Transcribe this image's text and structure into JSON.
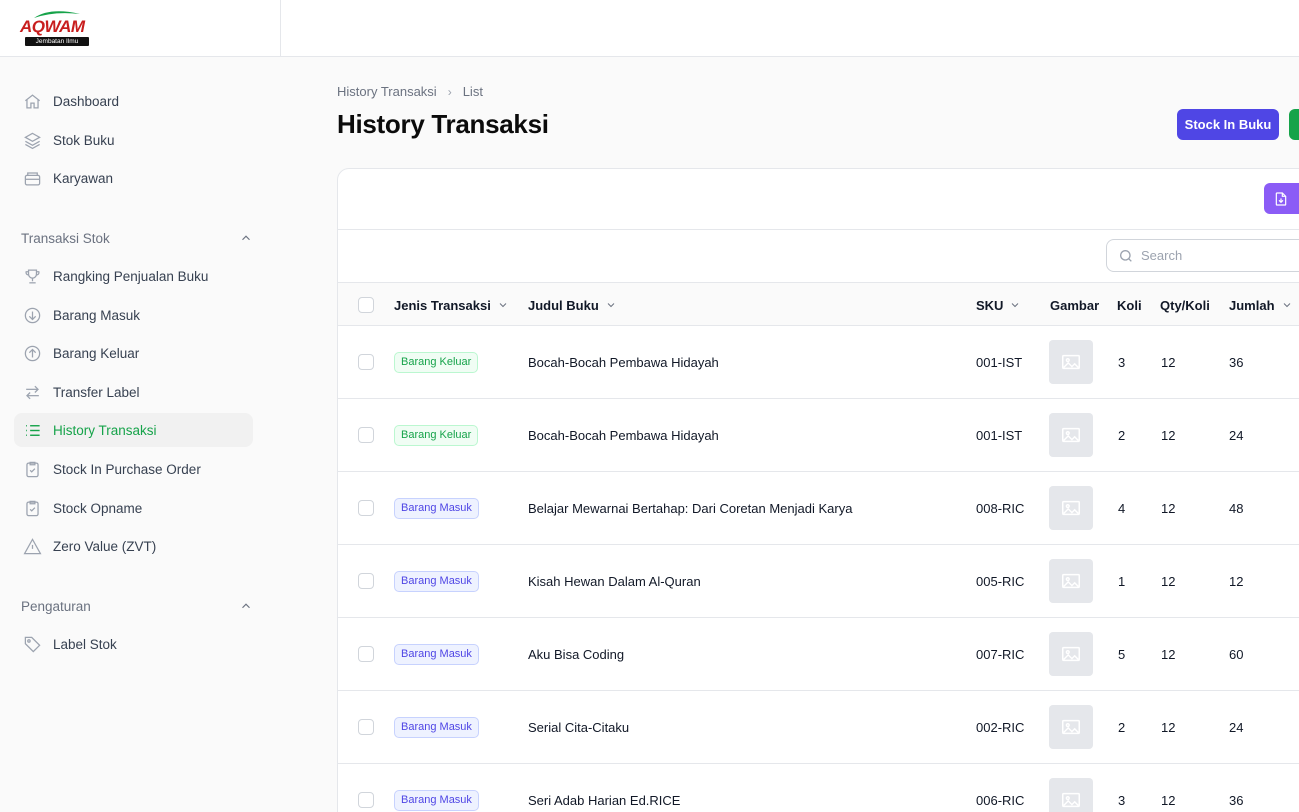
{
  "brand": {
    "name": "AQWAM",
    "tagline": "Jembatan Ilmu"
  },
  "sidebar": {
    "top_items": [
      {
        "label": "Dashboard",
        "icon": "home-icon"
      },
      {
        "label": "Stok Buku",
        "icon": "layers-icon"
      },
      {
        "label": "Karyawan",
        "icon": "inbox-icon"
      }
    ],
    "groups": [
      {
        "title": "Transaksi Stok",
        "items": [
          {
            "label": "Rangking Penjualan Buku",
            "icon": "trophy-icon"
          },
          {
            "label": "Barang Masuk",
            "icon": "arrow-down-circle-icon"
          },
          {
            "label": "Barang Keluar",
            "icon": "arrow-up-circle-icon"
          },
          {
            "label": "Transfer Label",
            "icon": "arrows-right-left-icon"
          },
          {
            "label": "History Transaksi",
            "icon": "list-icon",
            "active": true
          },
          {
            "label": "Stock In Purchase Order",
            "icon": "clipboard-check-icon"
          },
          {
            "label": "Stock Opname",
            "icon": "clipboard-check-icon"
          },
          {
            "label": "Zero Value (ZVT)",
            "icon": "warning-icon"
          }
        ]
      },
      {
        "title": "Pengaturan",
        "items": [
          {
            "label": "Label Stok",
            "icon": "tag-icon"
          }
        ]
      }
    ]
  },
  "breadcrumb": {
    "parent": "History Transaksi",
    "current": "List"
  },
  "page": {
    "title": "History Transaksi",
    "primary_action": "Stock In Buku"
  },
  "table": {
    "search_placeholder": "Search",
    "columns": {
      "jenis": "Jenis Transaksi",
      "judul": "Judul Buku",
      "sku": "SKU",
      "gambar": "Gambar",
      "koli": "Koli",
      "qty": "Qty/Koli",
      "jumlah": "Jumlah"
    },
    "rows": [
      {
        "jenis": "Barang Keluar",
        "type": "keluar",
        "judul": "Bocah-Bocah Pembawa Hidayah",
        "sku": "001-IST",
        "koli": "3",
        "qty": "12",
        "jumlah": "36"
      },
      {
        "jenis": "Barang Keluar",
        "type": "keluar",
        "judul": "Bocah-Bocah Pembawa Hidayah",
        "sku": "001-IST",
        "koli": "2",
        "qty": "12",
        "jumlah": "24"
      },
      {
        "jenis": "Barang Masuk",
        "type": "masuk",
        "judul": "Belajar Mewarnai Bertahap: Dari Coretan Menjadi Karya",
        "sku": "008-RIC",
        "koli": "4",
        "qty": "12",
        "jumlah": "48"
      },
      {
        "jenis": "Barang Masuk",
        "type": "masuk",
        "judul": "Kisah Hewan Dalam Al-Quran",
        "sku": "005-RIC",
        "koli": "1",
        "qty": "12",
        "jumlah": "12"
      },
      {
        "jenis": "Barang Masuk",
        "type": "masuk",
        "judul": "Aku Bisa Coding",
        "sku": "007-RIC",
        "koli": "5",
        "qty": "12",
        "jumlah": "60"
      },
      {
        "jenis": "Barang Masuk",
        "type": "masuk",
        "judul": "Serial Cita-Citaku",
        "sku": "002-RIC",
        "koli": "2",
        "qty": "12",
        "jumlah": "24"
      },
      {
        "jenis": "Barang Masuk",
        "type": "masuk",
        "judul": "Seri Adab Harian Ed.RICE",
        "sku": "006-RIC",
        "koli": "3",
        "qty": "12",
        "jumlah": "36"
      }
    ]
  },
  "colors": {
    "accent": "#16a34a",
    "primary": "#4f46e5",
    "export": "#8b5cf6"
  }
}
